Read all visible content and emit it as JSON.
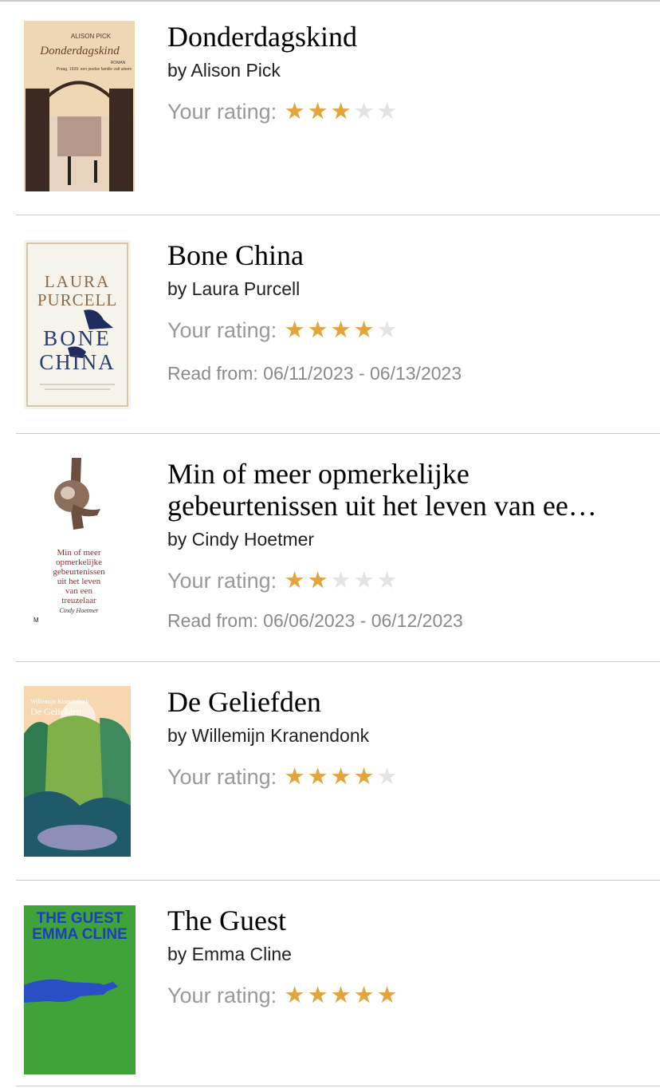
{
  "rating_label": "Your rating:",
  "colors": {
    "star_on": "#e2a53c",
    "star_off": "#e3e3e3"
  },
  "books": [
    {
      "title": "Donderdagskind",
      "author": "by Alison Pick",
      "rating": 3,
      "rating_max": 5,
      "read": "",
      "cover_text": [
        "ALISON PICK",
        "Donderdagskind",
        "Praag, 1939: een joodse familie valt uiteen",
        "ROMAN"
      ]
    },
    {
      "title": "Bone China",
      "author": "by Laura Purcell",
      "rating": 4,
      "rating_max": 5,
      "read": "Read from: 06/11/2023 - 06/13/2023",
      "cover_text": [
        "LAURA",
        "PURCELL",
        "BONE",
        "CHINA"
      ]
    },
    {
      "title": "Min of meer opmerkelijke gebeurtenissen uit het leven van ee…",
      "author": "by Cindy Hoetmer",
      "rating": 2,
      "rating_max": 5,
      "read": "Read from: 06/06/2023 - 06/12/2023",
      "cover_text": [
        "Min of meer",
        "opmerkelijke",
        "gebeurtenissen",
        "uit het leven",
        "van een",
        "treuzelaar",
        "Cindy Hoetmer",
        "M"
      ]
    },
    {
      "title": "De Geliefden",
      "author": "by Willemijn Kranendonk",
      "rating": 4,
      "rating_max": 5,
      "read": "",
      "cover_text": [
        "Willemijn Kranendonk",
        "De Geliefden"
      ]
    },
    {
      "title": "The Guest",
      "author": "by Emma Cline",
      "rating": 5,
      "rating_max": 5,
      "read": "",
      "cover_text": [
        "THE GUEST",
        "EMMA CLINE"
      ]
    }
  ]
}
